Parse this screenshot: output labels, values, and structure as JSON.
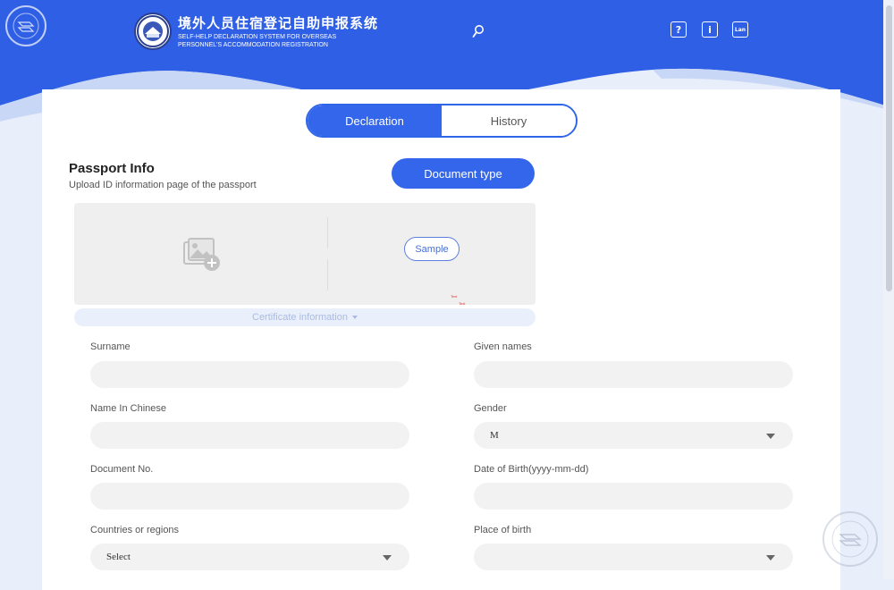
{
  "colors": {
    "brand_blue": "#2f5fe5",
    "accent": "#3366ea",
    "field_bg": "#f2f2f2"
  },
  "header": {
    "title_cn": "境外人员住宿登记自助申报系统",
    "title_en_line1": "SELF-HELP DECLARATION SYSTEM FOR OVERSEAS",
    "title_en_line2": "PERSONNEL'S ACCOMMODATION REGISTRATION",
    "buttons": {
      "help": "?",
      "info": "i",
      "lang": "Lan"
    },
    "icons": [
      "search-icon",
      "help-icon",
      "info-icon",
      "language-icon"
    ]
  },
  "tabs": {
    "declaration": "Declaration",
    "history": "History"
  },
  "passport": {
    "title": "Passport Info",
    "subtitle": "Upload ID information page of the passport",
    "doc_type_button": "Document type",
    "sample_button": "Sample",
    "tiny_text_1": "Text",
    "tiny_text_2": "Text",
    "cert_info": "Certificate information"
  },
  "form": {
    "surname": {
      "label": "Surname",
      "value": ""
    },
    "given_names": {
      "label": "Given names",
      "value": ""
    },
    "name_chinese": {
      "label": "Name In Chinese",
      "value": ""
    },
    "gender": {
      "label": "Gender",
      "value": "M"
    },
    "document_no": {
      "label": "Document No.",
      "value": ""
    },
    "dob": {
      "label": "Date of Birth(yyyy-mm-dd)",
      "value": ""
    },
    "countries": {
      "label": "Countries or regions",
      "value": "Select"
    },
    "place_of_birth": {
      "label": "Place of birth",
      "value": ""
    }
  }
}
